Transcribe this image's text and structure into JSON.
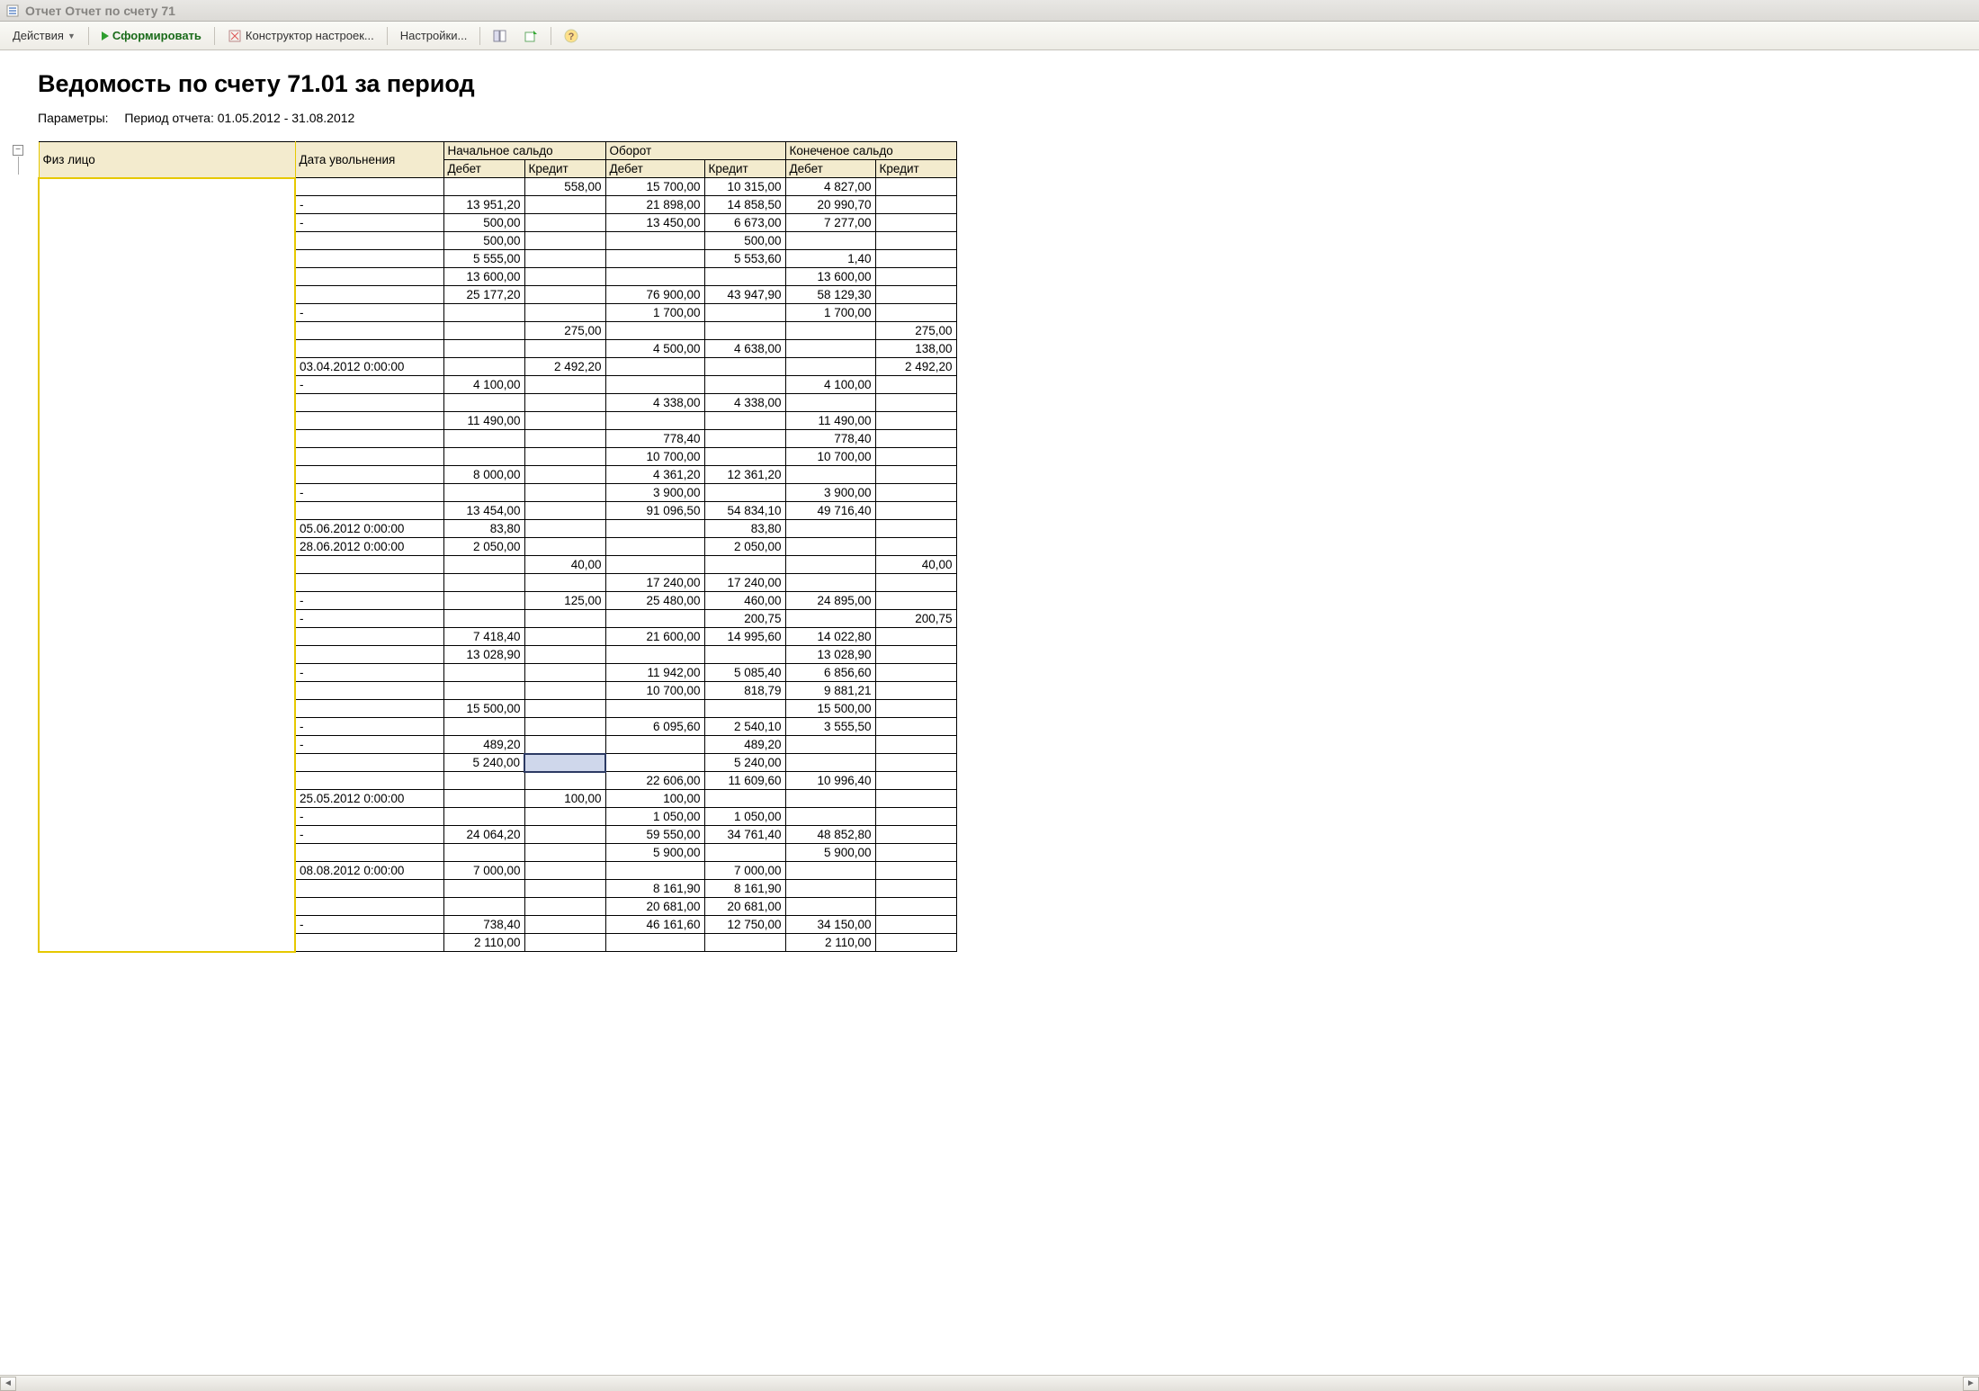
{
  "window": {
    "title": "Отчет  Отчет по счету 71"
  },
  "toolbar": {
    "actions": "Действия",
    "form": "Сформировать",
    "constructor": "Конструктор настроек...",
    "settings": "Настройки..."
  },
  "report": {
    "title": "Ведомость по счету 71.01 за период",
    "params_label": "Параметры:",
    "params_value": "Период отчета: 01.05.2012 - 31.08.2012"
  },
  "headers": {
    "fiz": "Физ лицо",
    "date": "Дата увольнения",
    "begin": "Начальное сальдо",
    "turnover": "Оборот",
    "end": "Конеченое сальдо",
    "debit": "Дебет",
    "credit": "Кредит"
  },
  "rows": [
    {
      "date": "",
      "bd": "",
      "bc": "558,00",
      "td": "15 700,00",
      "tc": "10 315,00",
      "ed": "4 827,00",
      "ec": ""
    },
    {
      "date": "-",
      "bd": "13 951,20",
      "bc": "",
      "td": "21 898,00",
      "tc": "14 858,50",
      "ed": "20 990,70",
      "ec": ""
    },
    {
      "date": "-",
      "bd": "500,00",
      "bc": "",
      "td": "13 450,00",
      "tc": "6 673,00",
      "ed": "7 277,00",
      "ec": ""
    },
    {
      "date": "",
      "bd": "500,00",
      "bc": "",
      "td": "",
      "tc": "500,00",
      "ed": "",
      "ec": ""
    },
    {
      "date": "",
      "bd": "5 555,00",
      "bc": "",
      "td": "",
      "tc": "5 553,60",
      "ed": "1,40",
      "ec": ""
    },
    {
      "date": "",
      "bd": "13 600,00",
      "bc": "",
      "td": "",
      "tc": "",
      "ed": "13 600,00",
      "ec": ""
    },
    {
      "date": "",
      "bd": "25 177,20",
      "bc": "",
      "td": "76 900,00",
      "tc": "43 947,90",
      "ed": "58 129,30",
      "ec": ""
    },
    {
      "date": "-",
      "bd": "",
      "bc": "",
      "td": "1 700,00",
      "tc": "",
      "ed": "1 700,00",
      "ec": ""
    },
    {
      "date": "",
      "bd": "",
      "bc": "275,00",
      "td": "",
      "tc": "",
      "ed": "",
      "ec": "275,00"
    },
    {
      "date": "",
      "bd": "",
      "bc": "",
      "td": "4 500,00",
      "tc": "4 638,00",
      "ed": "",
      "ec": "138,00"
    },
    {
      "date": "03.04.2012 0:00:00",
      "bd": "",
      "bc": "2 492,20",
      "td": "",
      "tc": "",
      "ed": "",
      "ec": "2 492,20"
    },
    {
      "date": "-",
      "bd": "4 100,00",
      "bc": "",
      "td": "",
      "tc": "",
      "ed": "4 100,00",
      "ec": ""
    },
    {
      "date": "",
      "bd": "",
      "bc": "",
      "td": "4 338,00",
      "tc": "4 338,00",
      "ed": "",
      "ec": ""
    },
    {
      "date": "",
      "bd": "11 490,00",
      "bc": "",
      "td": "",
      "tc": "",
      "ed": "11 490,00",
      "ec": ""
    },
    {
      "date": "",
      "bd": "",
      "bc": "",
      "td": "778,40",
      "tc": "",
      "ed": "778,40",
      "ec": ""
    },
    {
      "date": "",
      "bd": "",
      "bc": "",
      "td": "10 700,00",
      "tc": "",
      "ed": "10 700,00",
      "ec": ""
    },
    {
      "date": "",
      "bd": "8 000,00",
      "bc": "",
      "td": "4 361,20",
      "tc": "12 361,20",
      "ed": "",
      "ec": ""
    },
    {
      "date": "-",
      "bd": "",
      "bc": "",
      "td": "3 900,00",
      "tc": "",
      "ed": "3 900,00",
      "ec": ""
    },
    {
      "date": "",
      "bd": "13 454,00",
      "bc": "",
      "td": "91 096,50",
      "tc": "54 834,10",
      "ed": "49 716,40",
      "ec": ""
    },
    {
      "date": "05.06.2012 0:00:00",
      "bd": "83,80",
      "bc": "",
      "td": "",
      "tc": "83,80",
      "ed": "",
      "ec": ""
    },
    {
      "date": "28.06.2012 0:00:00",
      "bd": "2 050,00",
      "bc": "",
      "td": "",
      "tc": "2 050,00",
      "ed": "",
      "ec": ""
    },
    {
      "date": "",
      "bd": "",
      "bc": "40,00",
      "td": "",
      "tc": "",
      "ed": "",
      "ec": "40,00"
    },
    {
      "date": "",
      "bd": "",
      "bc": "",
      "td": "17 240,00",
      "tc": "17 240,00",
      "ed": "",
      "ec": ""
    },
    {
      "date": "-",
      "bd": "",
      "bc": "125,00",
      "td": "25 480,00",
      "tc": "460,00",
      "ed": "24 895,00",
      "ec": ""
    },
    {
      "date": "-",
      "bd": "",
      "bc": "",
      "td": "",
      "tc": "200,75",
      "ed": "",
      "ec": "200,75"
    },
    {
      "date": "",
      "bd": "7 418,40",
      "bc": "",
      "td": "21 600,00",
      "tc": "14 995,60",
      "ed": "14 022,80",
      "ec": ""
    },
    {
      "date": "",
      "bd": "13 028,90",
      "bc": "",
      "td": "",
      "tc": "",
      "ed": "13 028,90",
      "ec": ""
    },
    {
      "date": "-",
      "bd": "",
      "bc": "",
      "td": "11 942,00",
      "tc": "5 085,40",
      "ed": "6 856,60",
      "ec": ""
    },
    {
      "date": "",
      "bd": "",
      "bc": "",
      "td": "10 700,00",
      "tc": "818,79",
      "ed": "9 881,21",
      "ec": ""
    },
    {
      "date": "",
      "bd": "15 500,00",
      "bc": "",
      "td": "",
      "tc": "",
      "ed": "15 500,00",
      "ec": ""
    },
    {
      "date": "-",
      "bd": "",
      "bc": "",
      "td": "6 095,60",
      "tc": "2 540,10",
      "ed": "3 555,50",
      "ec": ""
    },
    {
      "date": "-",
      "bd": "489,20",
      "bc": "",
      "td": "",
      "tc": "489,20",
      "ed": "",
      "ec": ""
    },
    {
      "date": "",
      "bd": "5 240,00",
      "bc": "",
      "td": "",
      "tc": "5 240,00",
      "ed": "",
      "ec": "",
      "sel": "bc"
    },
    {
      "date": "",
      "bd": "",
      "bc": "",
      "td": "22 606,00",
      "tc": "11 609,60",
      "ed": "10 996,40",
      "ec": ""
    },
    {
      "date": "25.05.2012 0:00:00",
      "bd": "",
      "bc": "100,00",
      "td": "100,00",
      "tc": "",
      "ed": "",
      "ec": ""
    },
    {
      "date": "-",
      "bd": "",
      "bc": "",
      "td": "1 050,00",
      "tc": "1 050,00",
      "ed": "",
      "ec": ""
    },
    {
      "date": "-",
      "bd": "24 064,20",
      "bc": "",
      "td": "59 550,00",
      "tc": "34 761,40",
      "ed": "48 852,80",
      "ec": ""
    },
    {
      "date": "",
      "bd": "",
      "bc": "",
      "td": "5 900,00",
      "tc": "",
      "ed": "5 900,00",
      "ec": ""
    },
    {
      "date": "08.08.2012 0:00:00",
      "bd": "7 000,00",
      "bc": "",
      "td": "",
      "tc": "7 000,00",
      "ed": "",
      "ec": ""
    },
    {
      "date": "",
      "bd": "",
      "bc": "",
      "td": "8 161,90",
      "tc": "8 161,90",
      "ed": "",
      "ec": ""
    },
    {
      "date": "",
      "bd": "",
      "bc": "",
      "td": "20 681,00",
      "tc": "20 681,00",
      "ed": "",
      "ec": ""
    },
    {
      "date": "-",
      "bd": "738,40",
      "bc": "",
      "td": "46 161,60",
      "tc": "12 750,00",
      "ed": "34 150,00",
      "ec": ""
    },
    {
      "date": "",
      "bd": "2 110,00",
      "bc": "",
      "td": "",
      "tc": "",
      "ed": "2 110,00",
      "ec": ""
    }
  ]
}
